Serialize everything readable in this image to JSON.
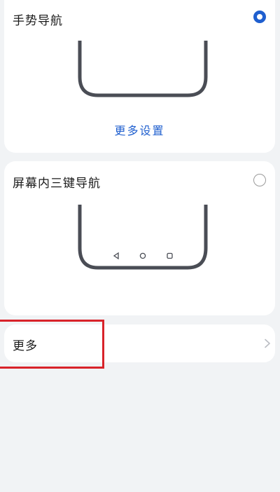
{
  "options": {
    "gesture": {
      "label": "手势导航",
      "selected": true,
      "more_settings_label": "更多设置"
    },
    "three_key": {
      "label": "屏幕内三键导航",
      "selected": false
    }
  },
  "more_row": {
    "label": "更多"
  },
  "colors": {
    "accent": "#1f5fcf",
    "phone_outline": "#4a4d55",
    "highlight": "#d8232a",
    "background": "#f1f3f5"
  }
}
